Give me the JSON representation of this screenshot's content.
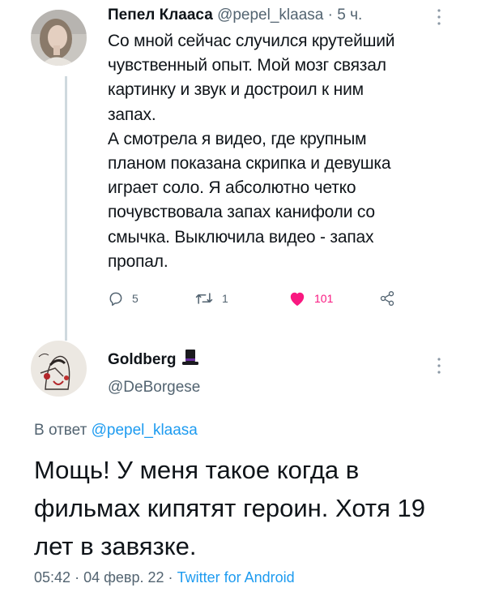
{
  "tweet": {
    "author_name": "Пепел Клааса",
    "author_handle": "@pepel_klaasa",
    "separator": "·",
    "time_ago": "5 ч.",
    "text": "Со мной сейчас случился крутейший\nчувственный опыт. Мой мозг связал\nкартинку и звук и достроил к ним\nзапах.\nА смотрела я видео, где крупным\nпланом показана скрипка и девушка\nиграет соло. Я абсолютно четко\nпочувствовала запах канифоли со\nсмычка. Выключила видео - запах\nпропал.",
    "actions": {
      "replies": "5",
      "retweets": "1",
      "likes": "101"
    }
  },
  "reply": {
    "author_name": "Goldberg",
    "author_handle": "@DeBorgese",
    "reply_prefix": "В ответ",
    "reply_to_handle": "@pepel_klaasa",
    "text": "Мощь! У меня такое когда в фильмах кипятят героин. Хотя 19 лет в завязке.",
    "time": "05:42",
    "date": "04 февр. 22",
    "separator": "·",
    "source": "Twitter for Android"
  },
  "icons": {
    "reply": "reply-icon",
    "retweet": "retweet-icon",
    "like": "heart-icon",
    "share": "share-icon",
    "more": "more-icon",
    "top_hat": "top-hat-icon"
  },
  "colors": {
    "text": "#0f1419",
    "muted": "#536471",
    "link": "#1d9bf0",
    "like": "#f91880",
    "thread_line": "#cfd9de"
  }
}
